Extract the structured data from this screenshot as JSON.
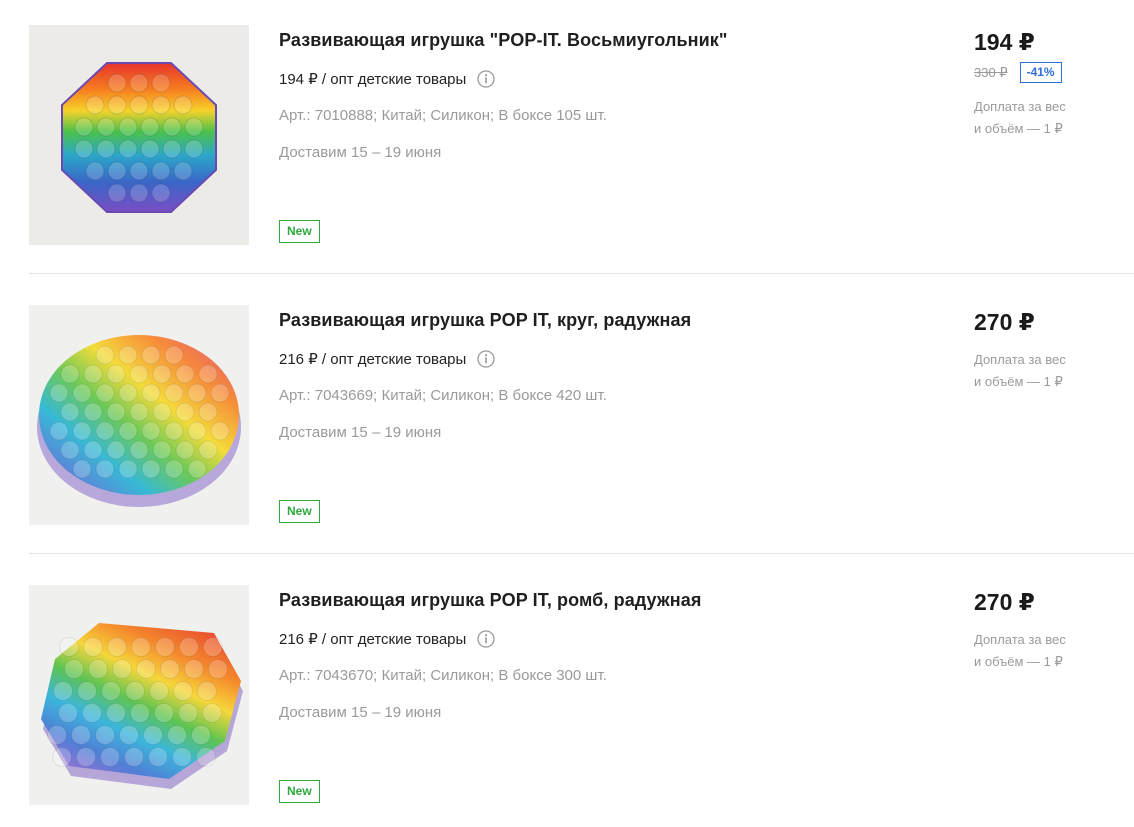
{
  "products": [
    {
      "title": "Развивающая игрушка \"POP-IT. Восьмиугольник\"",
      "wholesale": "194 ₽ / опт детские товары",
      "meta": "Арт.: 7010888; Китай;  Силикон;  В боксе 105 шт.",
      "delivery": "Доставим 15 – 19 июня",
      "badge": "New",
      "price": "194 ₽",
      "old_price": "330 ₽",
      "discount": "-41%",
      "surcharge_line1": "Доплата за вес",
      "surcharge_line2": "и объём — 1 ₽",
      "image_icon": "octagon-pop-it-image"
    },
    {
      "title": "Развивающая игрушка POP IT, круг, радужная",
      "wholesale": "216 ₽ / опт детские товары",
      "meta": "Арт.: 7043669; Китай;  Силикон;  В боксе 420 шт.",
      "delivery": "Доставим 15 – 19 июня",
      "badge": "New",
      "price": "270 ₽",
      "surcharge_line1": "Доплата за вес",
      "surcharge_line2": "и объём — 1 ₽",
      "image_icon": "circle-pop-it-image"
    },
    {
      "title": "Развивающая игрушка POP IT, ромб, радужная",
      "wholesale": "216 ₽ / опт детские товары",
      "meta": "Арт.: 7043670; Китай;  Силикон;  В боксе 300 шт.",
      "delivery": "Доставим 15 – 19 июня",
      "badge": "New",
      "price": "270 ₽",
      "surcharge_line1": "Доплата за вес",
      "surcharge_line2": "и объём — 1 ₽",
      "image_icon": "rhombus-pop-it-image"
    }
  ],
  "colors": {
    "new_badge": "#2eaa3f",
    "discount_badge": "#2f6fd8",
    "muted_text": "#9a9a9a",
    "divider": "#e2e2e2"
  }
}
